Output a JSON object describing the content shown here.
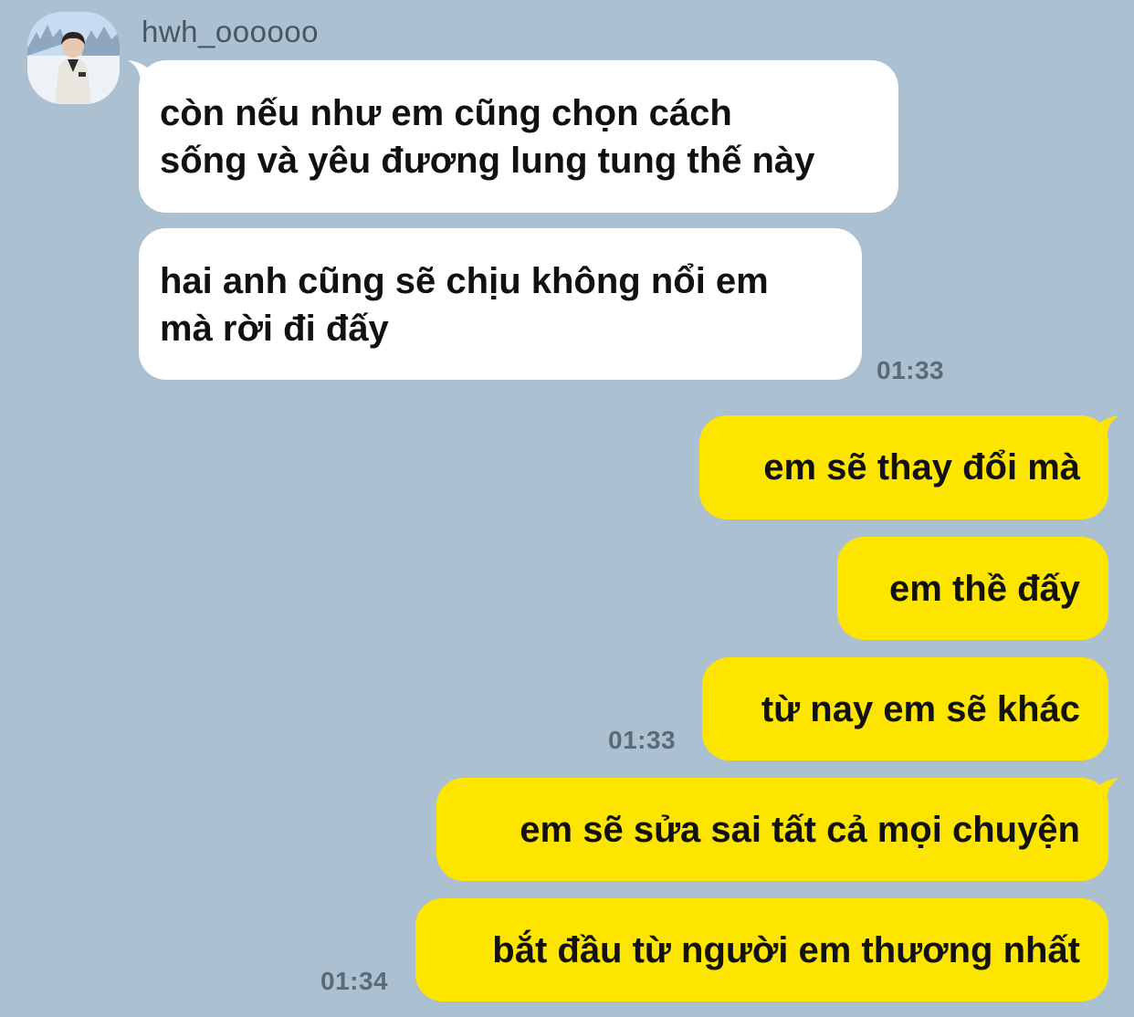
{
  "sender": {
    "name": "hwh_oooooo",
    "avatar": "profile-photo"
  },
  "messages": {
    "m1": {
      "line1": "còn nếu như em cũng chọn cách",
      "line2": "sống và yêu đương lung tung thế này"
    },
    "m2": {
      "line1": "hai anh cũng sẽ chịu không nổi em",
      "line2": "mà rời đi đấy",
      "time": "01:33"
    },
    "m3": {
      "text": "em sẽ thay đổi mà"
    },
    "m4": {
      "text": "em thề đấy"
    },
    "m5": {
      "text": "từ nay em sẽ khác",
      "time": "01:33"
    },
    "m6": {
      "text": "em sẽ sửa sai tất cả mọi chuyện"
    },
    "m7": {
      "text": "bắt đầu từ người em thương nhất",
      "time": "01:34"
    }
  },
  "colors": {
    "background": "#abc1d1",
    "incoming_bubble": "#ffffff",
    "outgoing_bubble": "#fee500"
  }
}
